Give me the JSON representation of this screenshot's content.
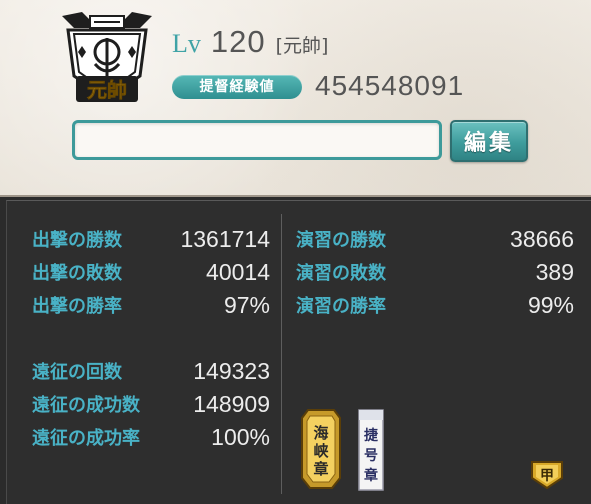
{
  "profile": {
    "lv_label": "Lv",
    "level": "120",
    "rank": "[元帥]",
    "emblem_text": "元帥",
    "exp_label": "提督経験値",
    "exp_value": "454548091",
    "comment_value": "",
    "edit_label": "編集"
  },
  "sortie": [
    {
      "label": "出撃の勝数",
      "value": "1361714"
    },
    {
      "label": "出撃の敗数",
      "value": "40014"
    },
    {
      "label": "出撃の勝率",
      "value": "97%"
    }
  ],
  "exercise": [
    {
      "label": "演習の勝数",
      "value": "38666"
    },
    {
      "label": "演習の敗数",
      "value": "389"
    },
    {
      "label": "演習の勝率",
      "value": "99%"
    }
  ],
  "expedition": [
    {
      "label": "遠征の回数",
      "value": "149323"
    },
    {
      "label": "遠征の成功数",
      "value": "148909"
    },
    {
      "label": "遠征の成功率",
      "value": "100%"
    }
  ],
  "medals": {
    "gold_medal_text": "海峡章",
    "white_medal_text": "捷号章",
    "badge_text": "甲"
  },
  "colors": {
    "accent": "#3fa3a6",
    "stat_label": "#49b2c6",
    "stat_value": "#ececec",
    "panel_bg": "#2e2e2e"
  }
}
